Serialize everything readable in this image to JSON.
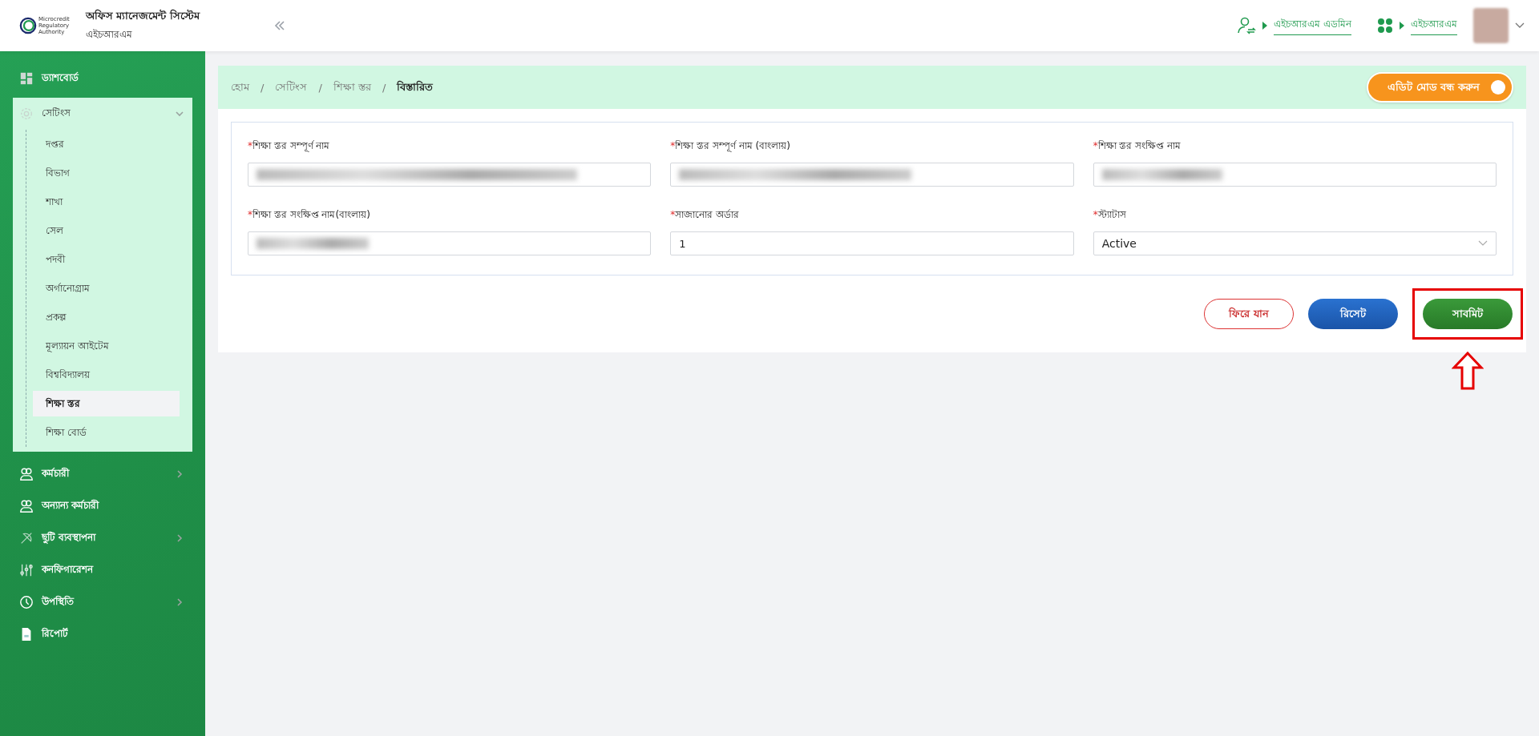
{
  "header": {
    "logo_lines": [
      "Microcredit",
      "Regulatory",
      "Authority"
    ],
    "app_title": "অফিস ম্যানেজমেন্ট সিস্টেম",
    "app_subtitle": "এইচআরএম",
    "role_link": "এইচআরএম এডমিন",
    "module_link": "এইচআরএম"
  },
  "sidebar": {
    "items": [
      {
        "label": "ড্যাশবোর্ড",
        "has_submenu": false,
        "expanded": false
      },
      {
        "label": "সেটিংস",
        "has_submenu": true,
        "expanded": true,
        "children": [
          {
            "label": "দপ্তর",
            "selected": false
          },
          {
            "label": "বিভাগ",
            "selected": false
          },
          {
            "label": "শাখা",
            "selected": false
          },
          {
            "label": "সেল",
            "selected": false
          },
          {
            "label": "পদবী",
            "selected": false
          },
          {
            "label": "অর্গানোগ্রাম",
            "selected": false
          },
          {
            "label": "প্রকল্প",
            "selected": false
          },
          {
            "label": "মূল্যায়ন আইটেম",
            "selected": false
          },
          {
            "label": "বিশ্ববিদ্যালয়",
            "selected": false
          },
          {
            "label": "শিক্ষা স্তর",
            "selected": true
          },
          {
            "label": "শিক্ষা বোর্ড",
            "selected": false
          }
        ]
      },
      {
        "label": "কর্মচারী",
        "has_submenu": true,
        "expanded": false
      },
      {
        "label": "অন্যান্য কর্মচারী",
        "has_submenu": false,
        "expanded": false
      },
      {
        "label": "ছুটি ব্যবস্থাপনা",
        "has_submenu": true,
        "expanded": false
      },
      {
        "label": "কনফিগারেশন",
        "has_submenu": false,
        "expanded": false
      },
      {
        "label": "উপস্থিতি",
        "has_submenu": true,
        "expanded": false
      },
      {
        "label": "রিপোর্ট",
        "has_submenu": false,
        "expanded": false
      }
    ]
  },
  "breadcrumb": [
    {
      "label": "হোম",
      "current": false
    },
    {
      "separator": "/",
      "label": "সেটিংস",
      "current": false
    },
    {
      "separator": "/",
      "label": "শিক্ষা স্তর",
      "current": false
    },
    {
      "separator": "/",
      "label": "বিস্তারিত",
      "current": true
    }
  ],
  "edit_toggle": {
    "label": "এডিট মোড বন্ধ করুন",
    "on": true
  },
  "form": {
    "fields": [
      {
        "required_mark": "*",
        "label": "শিক্ষা স্তর সম্পূর্ণ নাম",
        "kind": "blurred"
      },
      {
        "required_mark": "*",
        "label": "শিক্ষা স্তর সম্পূর্ণ নাম (বাংলায়)",
        "kind": "blurred"
      },
      {
        "required_mark": "*",
        "label": "শিক্ষা স্তর সংক্ষিপ্ত নাম",
        "kind": "blurred"
      },
      {
        "required_mark": "*",
        "label": "শিক্ষা স্তর সংক্ষিপ্ত নাম(বাংলায়)",
        "kind": "blurred"
      },
      {
        "required_mark": "*",
        "label": "সাজানোর অর্ডার",
        "kind": "text",
        "value": "1"
      },
      {
        "required_mark": "*",
        "label": "স্ট্যাটাস",
        "kind": "select",
        "value": "Active"
      }
    ]
  },
  "buttons": [
    {
      "label": "ফিরে যান",
      "kind": "back",
      "highlighted": false
    },
    {
      "label": "রিসেট",
      "kind": "reset",
      "highlighted": false
    },
    {
      "label": "সাবমিট",
      "kind": "submit",
      "highlighted": true
    }
  ]
}
